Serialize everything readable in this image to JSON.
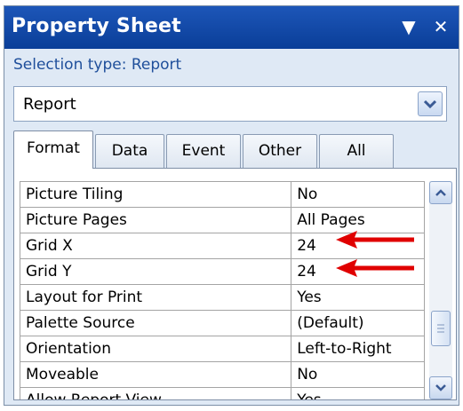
{
  "window": {
    "title": "Property Sheet",
    "dropdown_glyph": "▼",
    "close_glyph": "✕"
  },
  "selection_type": "Selection type: Report",
  "object_selector": {
    "value": "Report"
  },
  "tabs": [
    {
      "label": "Format",
      "active": true
    },
    {
      "label": "Data",
      "active": false
    },
    {
      "label": "Event",
      "active": false
    },
    {
      "label": "Other",
      "active": false
    },
    {
      "label": "All",
      "active": false
    }
  ],
  "properties": [
    {
      "name": "Picture Tiling",
      "value": "No"
    },
    {
      "name": "Picture Pages",
      "value": "All Pages"
    },
    {
      "name": "Grid X",
      "value": "24",
      "highlighted": true
    },
    {
      "name": "Grid Y",
      "value": "24",
      "highlighted": true
    },
    {
      "name": "Layout for Print",
      "value": "Yes"
    },
    {
      "name": "Palette Source",
      "value": "(Default)"
    },
    {
      "name": "Orientation",
      "value": "Left-to-Right"
    },
    {
      "name": "Moveable",
      "value": "No"
    },
    {
      "name": "Allow Report View",
      "value": "Yes"
    }
  ],
  "colors": {
    "titlebar": "#0a3e98",
    "annotation_arrow": "#e00000"
  },
  "icons": [
    "dropdown-arrow-icon",
    "close-icon",
    "combo-chevron-icon",
    "scroll-up-icon",
    "scroll-down-icon"
  ]
}
